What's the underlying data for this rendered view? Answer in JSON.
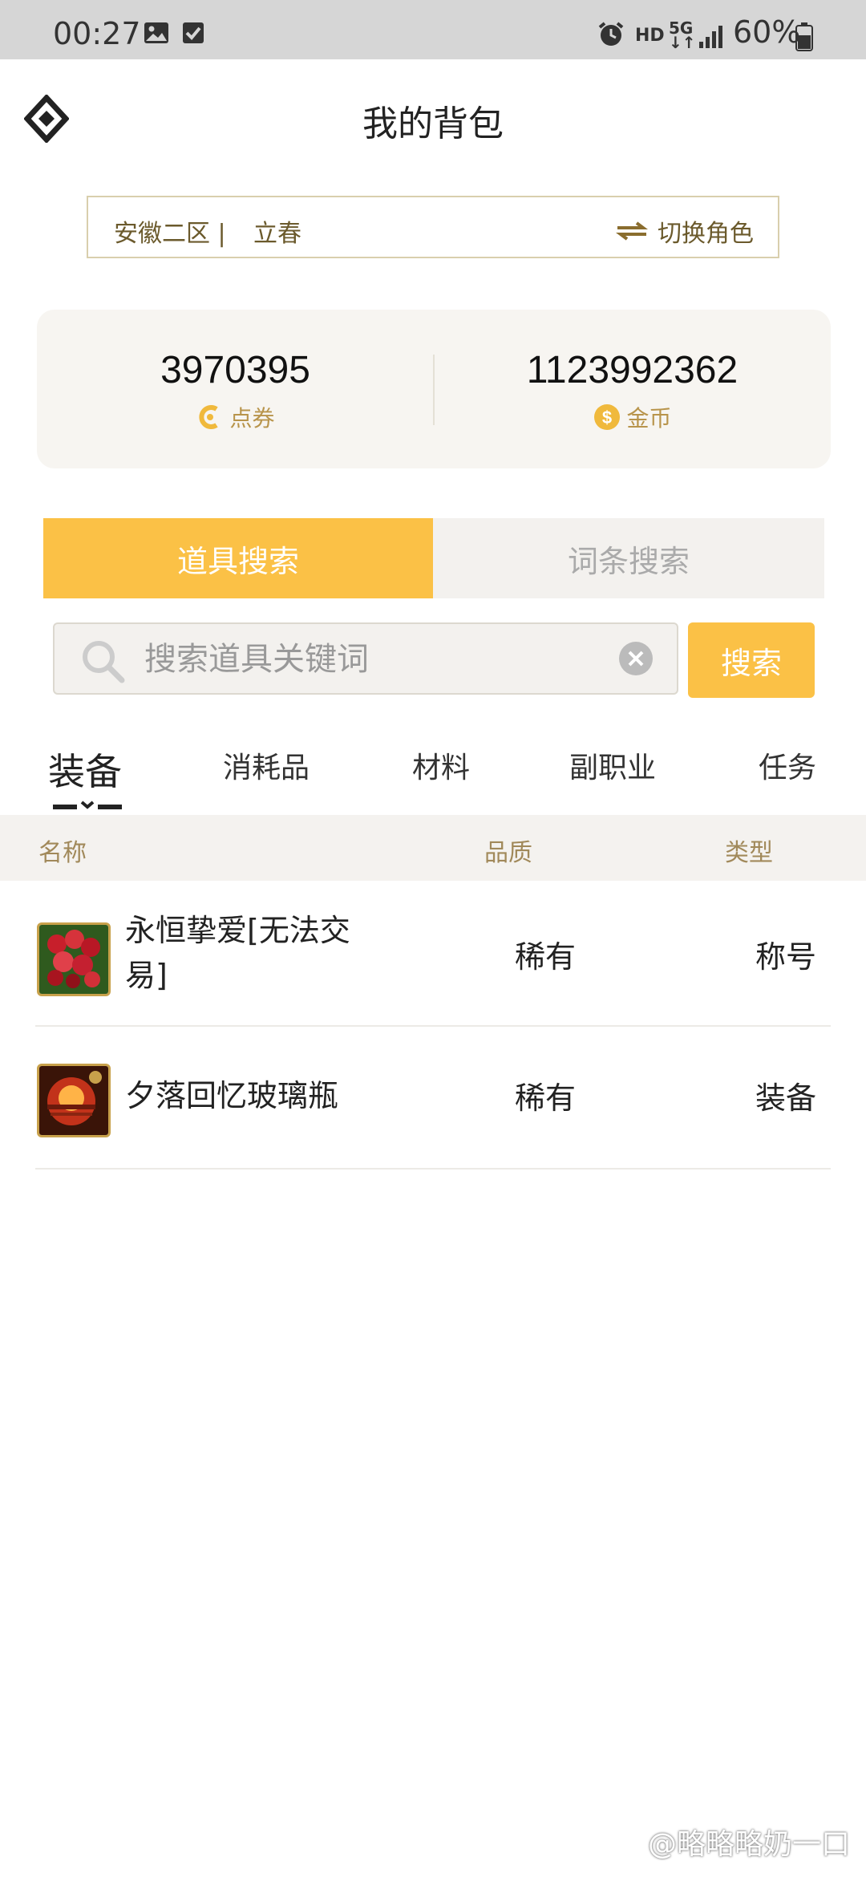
{
  "status_bar": {
    "time": "00:27",
    "network": "HD",
    "network_gen": "5G",
    "battery": "60%",
    "icons": [
      "image-icon",
      "check-icon",
      "alarm-icon",
      "signal-icon",
      "battery-icon"
    ]
  },
  "header": {
    "title": "我的背包"
  },
  "role": {
    "server": "安徽二区 |",
    "name": "立春",
    "switch_label": "切换角色"
  },
  "currency": {
    "points_value": "3970395",
    "points_label": "点券",
    "gold_value": "1123992362",
    "gold_label": "金币"
  },
  "search_modes": {
    "active": "道具搜索",
    "inactive": "词条搜索"
  },
  "search": {
    "placeholder": "搜索道具关键词",
    "button": "搜索"
  },
  "categories": [
    "装备",
    "消耗品",
    "材料",
    "副职业",
    "任务"
  ],
  "table": {
    "headers": {
      "name": "名称",
      "quality": "品质",
      "type": "类型"
    },
    "rows": [
      {
        "name": "永恒挚爱[无法交易]",
        "quality": "稀有",
        "type": "称号"
      },
      {
        "name": "夕落回忆玻璃瓶",
        "quality": "稀有",
        "type": "装备"
      }
    ]
  },
  "watermark": "@略略略奶一口",
  "colors": {
    "accent": "#fbc146",
    "brown_text": "#6b5a2c",
    "gold_label": "#b8944b"
  }
}
